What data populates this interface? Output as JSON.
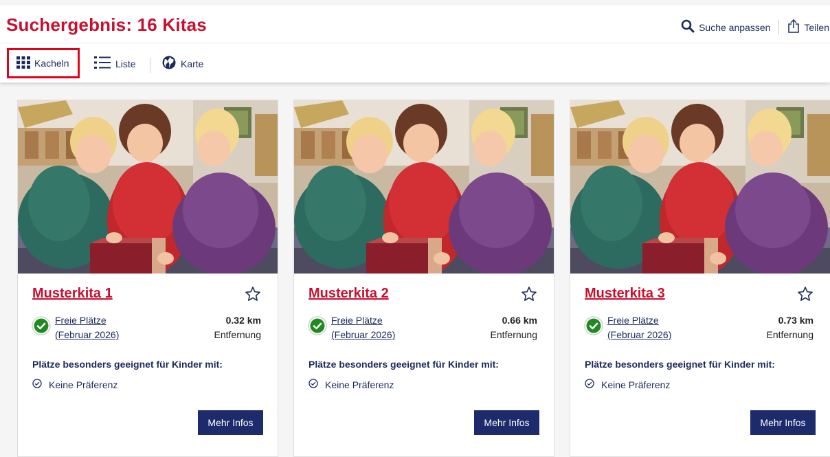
{
  "header": {
    "title": "Suchergebnis: 16 Kitas",
    "search_label": "Suche anpassen",
    "share_label": "Teilen"
  },
  "views": {
    "tiles_label": "Kacheln",
    "list_label": "Liste",
    "map_label": "Karte",
    "active": "Kacheln"
  },
  "colors": {
    "brand_red": "#c8102e",
    "navy": "#1d2a6b",
    "available_green": "#1f8a1f"
  },
  "cards": [
    {
      "name": "Musterkita 1",
      "availability_line1": "Freie Plätze",
      "availability_line2": "(Februar 2026)",
      "distance": "0.32 km",
      "distance_label": "Entfernung",
      "preference_heading": "Plätze besonders geeignet für Kinder mit:",
      "preference": "Keine Präferenz",
      "button_label": "Mehr Infos"
    },
    {
      "name": "Musterkita 2",
      "availability_line1": "Freie Plätze",
      "availability_line2": "(Februar 2026)",
      "distance": "0.66 km",
      "distance_label": "Entfernung",
      "preference_heading": "Plätze besonders geeignet für Kinder mit:",
      "preference": "Keine Präferenz",
      "button_label": "Mehr Infos"
    },
    {
      "name": "Musterkita 3",
      "availability_line1": "Freie Plätze",
      "availability_line2": "(Februar 2026)",
      "distance": "0.73 km",
      "distance_label": "Entfernung",
      "preference_heading": "Plätze besonders geeignet für Kinder mit:",
      "preference": "Keine Präferenz",
      "button_label": "Mehr Infos"
    }
  ]
}
